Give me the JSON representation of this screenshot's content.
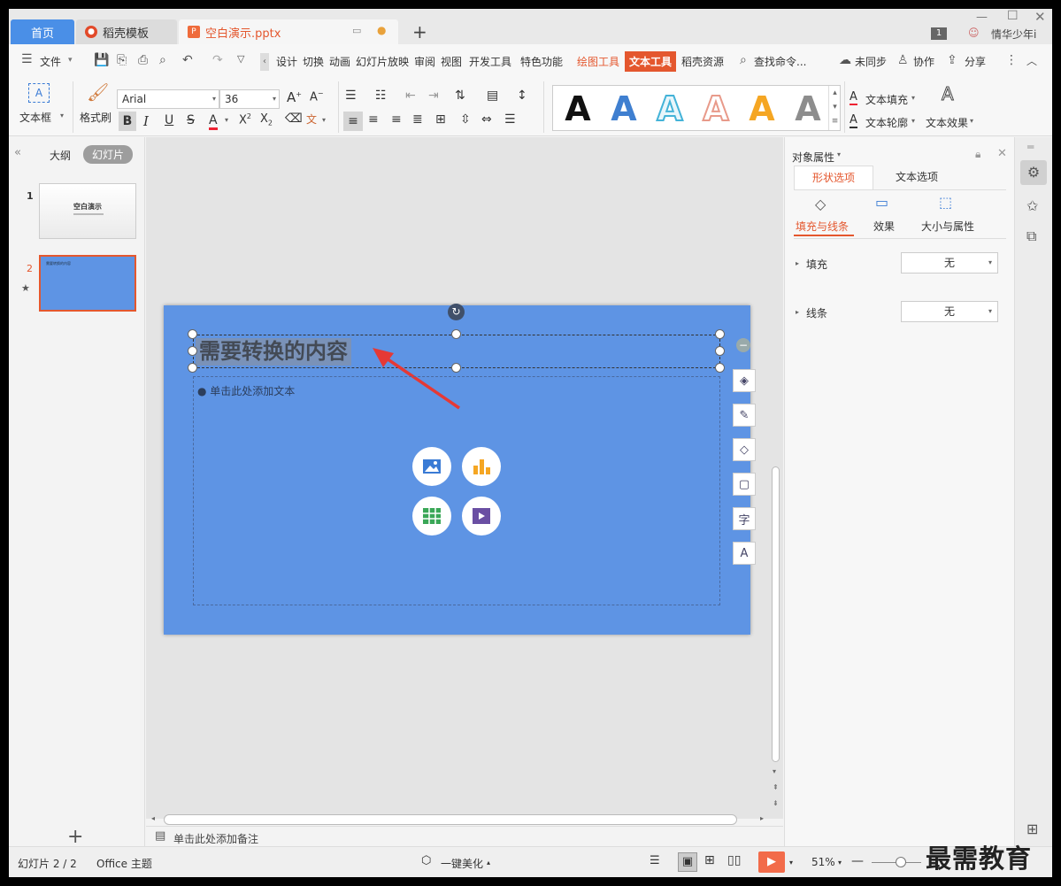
{
  "tabs": {
    "home": "首页",
    "template": "稻壳模板",
    "doc": "空白演示.pptx",
    "new": "+",
    "page_badge": "1",
    "user": "情华少年i"
  },
  "menu": {
    "file": "文件",
    "items": [
      "设计",
      "切换",
      "动画",
      "幻灯片放映",
      "审阅",
      "视图",
      "开发工具",
      "特色功能"
    ],
    "draw_tools": "绘图工具",
    "text_tools": "文本工具",
    "docer": "稻壳资源",
    "search": "查找命令...",
    "unsync": "未同步",
    "collab": "协作",
    "share": "分享"
  },
  "ribbon": {
    "textbox": "文本框",
    "painter": "格式刷",
    "font_family": "Arial",
    "font_size": "36",
    "text_fill": "文本填充",
    "text_outline": "文本轮廓",
    "text_effect": "文本效果",
    "gallery_letter": "A"
  },
  "leftpane": {
    "outline": "大纲",
    "slides": "幻灯片",
    "slide1_num": "1",
    "slide1_title": "空白演示",
    "slide2_num": "2",
    "slide2_title": "需要转换的内容",
    "add": "+"
  },
  "slide": {
    "title": "需要转换的内容",
    "body_placeholder": "单击此处添加文本"
  },
  "notes": {
    "placeholder": "单击此处添加备注"
  },
  "rpanel": {
    "header": "对象属性",
    "tab_shape": "形状选项",
    "tab_text": "文本选项",
    "sub_fill_line": "填充与线条",
    "sub_effect": "效果",
    "sub_size": "大小与属性",
    "fill_label": "填充",
    "fill_value": "无",
    "line_label": "线条",
    "line_value": "无"
  },
  "status": {
    "slide_info": "幻灯片 2 / 2",
    "theme": "Office 主题",
    "beautify": "一键美化",
    "zoom": "51%"
  },
  "watermark": "最需教育",
  "colors": {
    "accent_orange": "#e4572e",
    "slide_blue": "#5e94e4",
    "tab_blue": "#4a8fe7"
  }
}
